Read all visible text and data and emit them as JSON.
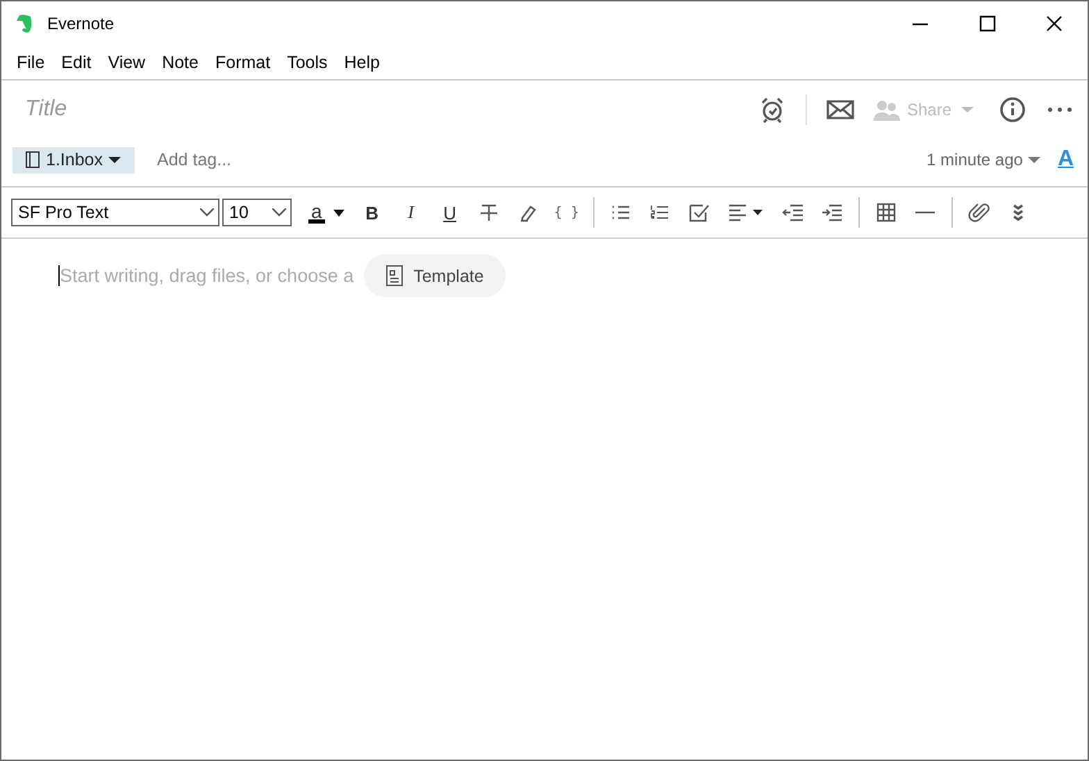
{
  "window": {
    "title": "Evernote"
  },
  "menu": [
    {
      "label": "File"
    },
    {
      "label": "Edit"
    },
    {
      "label": "View"
    },
    {
      "label": "Note"
    },
    {
      "label": "Format"
    },
    {
      "label": "Tools"
    },
    {
      "label": "Help"
    }
  ],
  "note": {
    "title_placeholder": "Title",
    "share_label": "Share",
    "share_disabled": true,
    "notebook": "1.Inbox",
    "tag_placeholder": "Add tag...",
    "updated": "1 minute ago",
    "font_style_label": "A"
  },
  "toolbar": {
    "font": "SF Pro Text",
    "size": "10",
    "text_color_label": "a",
    "buttons": [
      {
        "kind": "bold",
        "label": "B"
      },
      {
        "kind": "italic",
        "label": "I"
      },
      {
        "kind": "underline",
        "label": "U"
      },
      {
        "kind": "strike"
      },
      {
        "kind": "highlight"
      },
      {
        "kind": "code",
        "label": "{ }"
      },
      {
        "kind": "sep"
      },
      {
        "kind": "bullets"
      },
      {
        "kind": "numbers"
      },
      {
        "kind": "checkbox"
      },
      {
        "kind": "align"
      },
      {
        "kind": "outdent"
      },
      {
        "kind": "indent"
      },
      {
        "kind": "sep"
      },
      {
        "kind": "table"
      },
      {
        "kind": "rule"
      },
      {
        "kind": "sep"
      },
      {
        "kind": "attach"
      },
      {
        "kind": "more"
      }
    ]
  },
  "editor": {
    "placeholder": "Start writing, drag files, or choose a",
    "template_button": "Template"
  }
}
